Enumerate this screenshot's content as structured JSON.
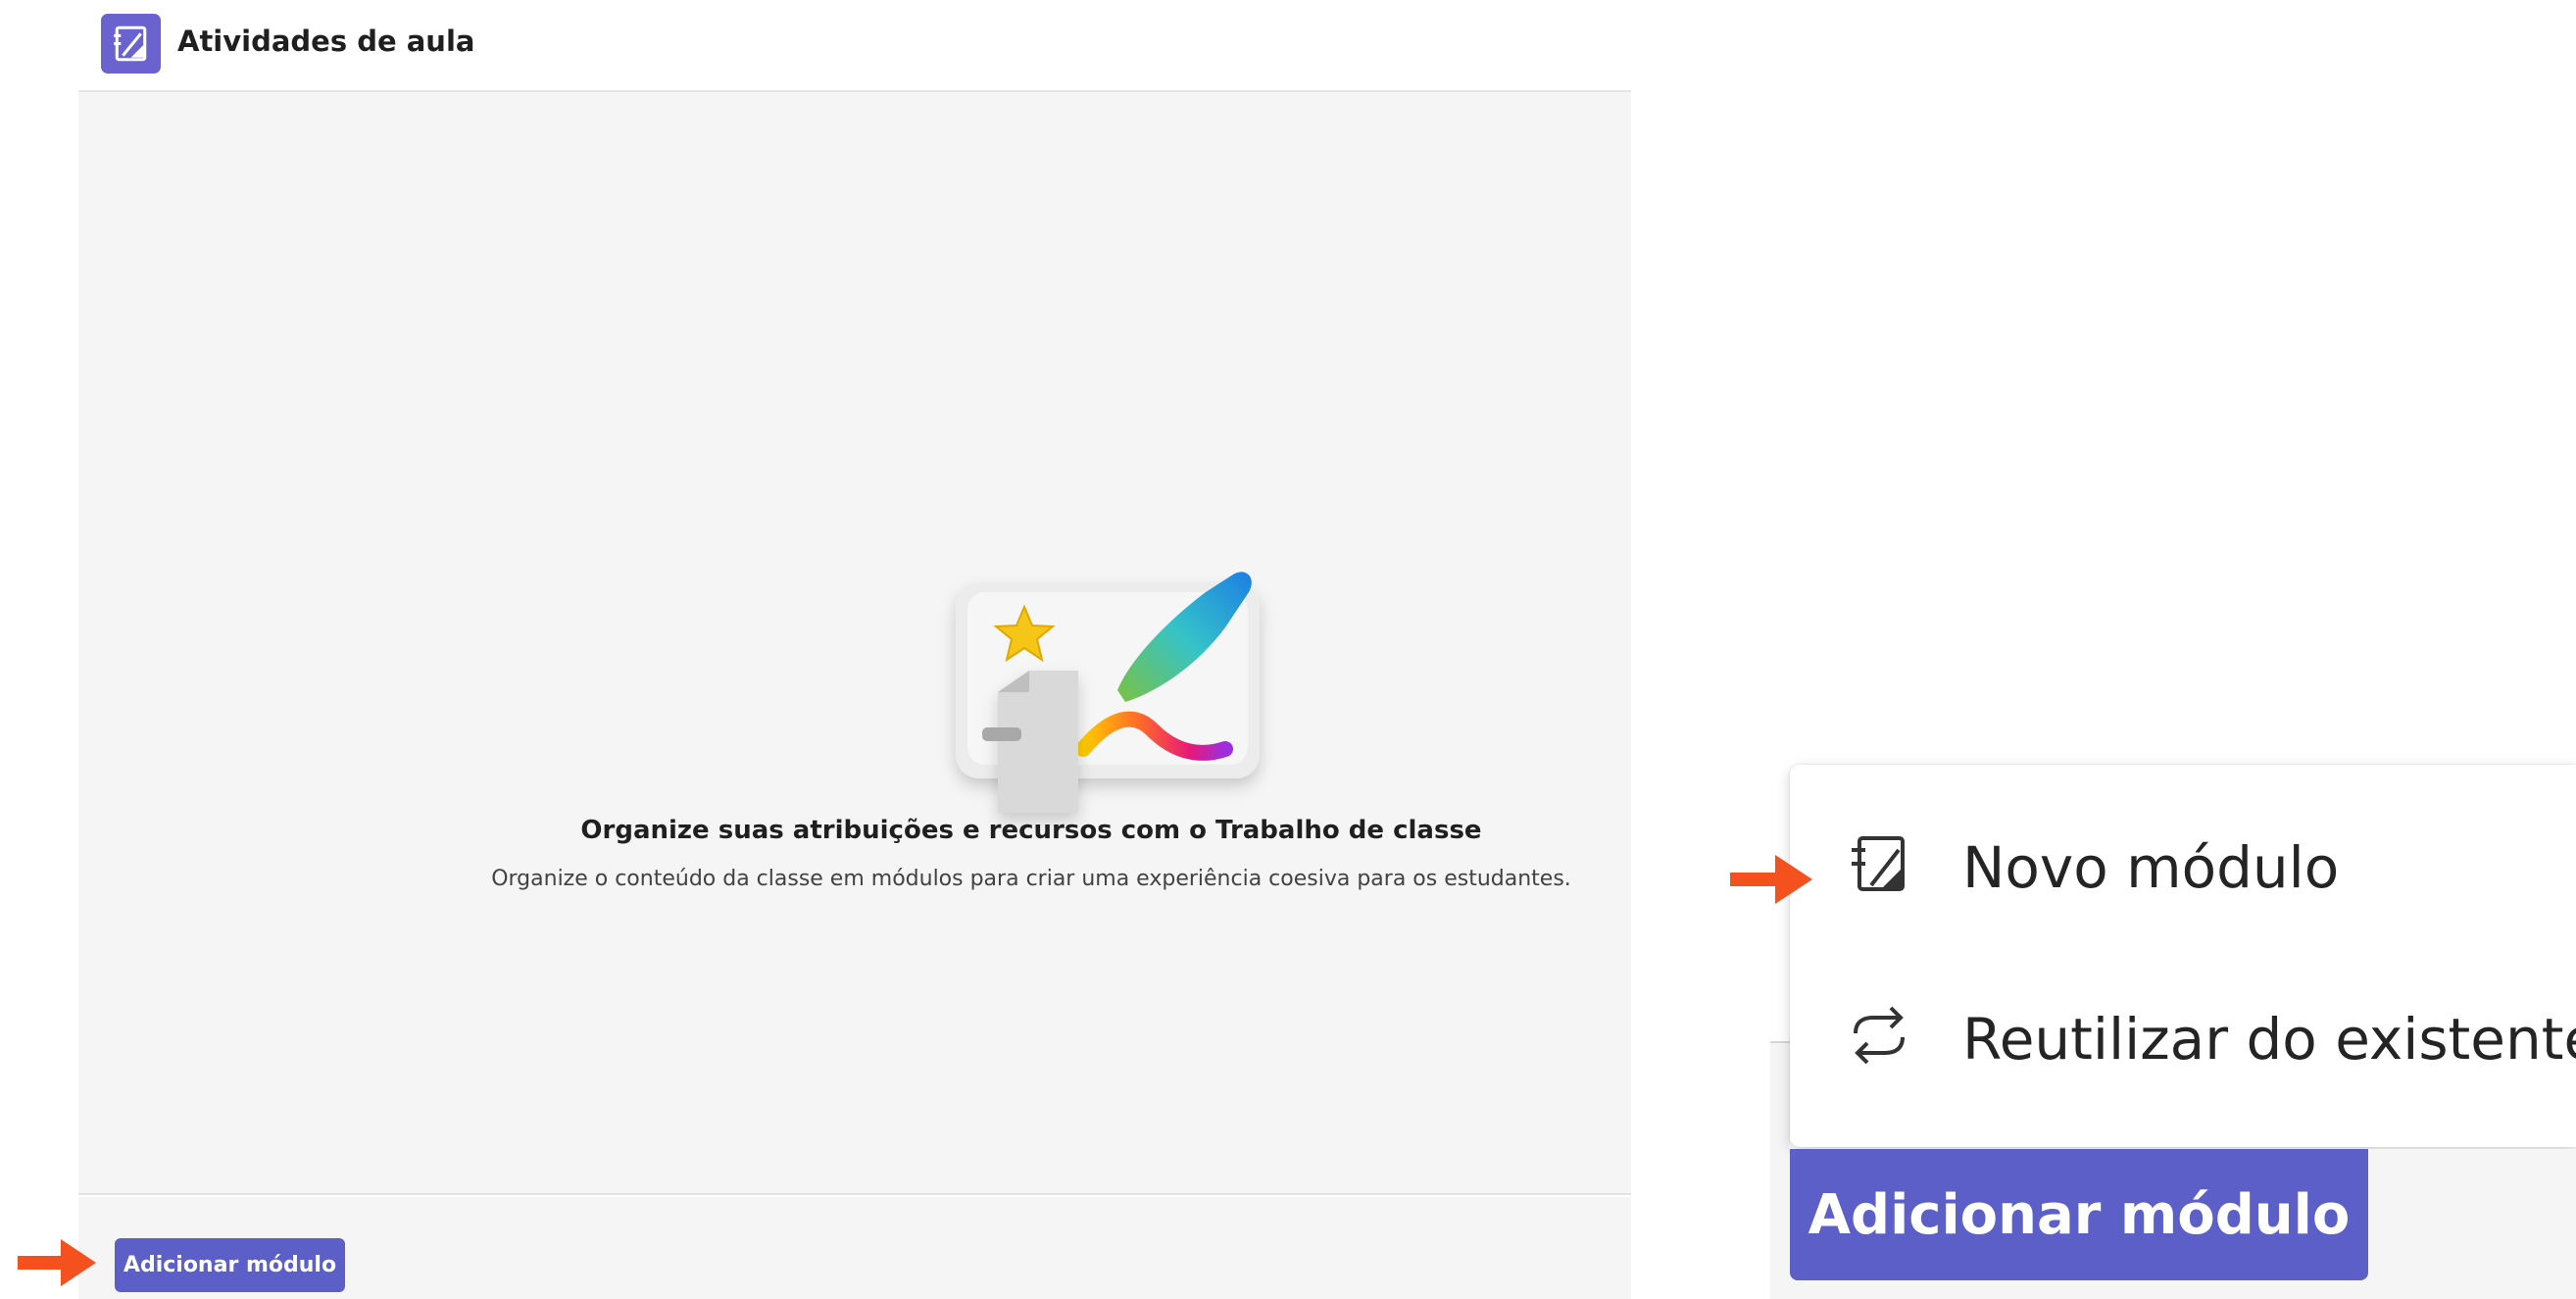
{
  "header": {
    "title": "Atividades de aula",
    "logo_icon": "classwork-icon"
  },
  "empty_state": {
    "title": "Organize suas atribuições e recursos com o Trabalho de classe",
    "description": "Organize o conteúdo da classe em módulos para criar uma experiência coesiva para os estudantes."
  },
  "footer": {
    "add_module_label": "Adicionar módulo"
  },
  "zoom": {
    "menu_items": [
      {
        "label": "Novo módulo",
        "icon": "new-module-icon"
      },
      {
        "label": "Reutilizar do existente",
        "icon": "reuse-icon"
      }
    ],
    "add_module_label": "Adicionar módulo"
  },
  "colors": {
    "accent": "#5b5fc7",
    "arrow": "#f4511e",
    "content_bg": "#f5f5f5"
  }
}
